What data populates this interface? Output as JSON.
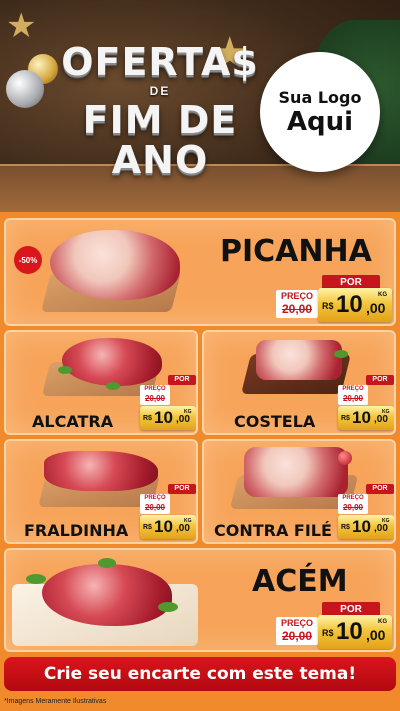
{
  "header": {
    "title_line1": "OFERTA$",
    "title_line2": "DE",
    "title_line3": "FIM DE ANO",
    "logo_line1": "Sua Logo",
    "logo_line2": "Aqui"
  },
  "products": [
    {
      "name": "PICANHA",
      "badge": "-50%",
      "por_label": "POR",
      "preco_label": "PREÇO",
      "old_price": "20,00",
      "currency": "R$",
      "price_int": "10",
      "price_cents": ",00",
      "unit": "KG"
    },
    {
      "name": "ALCATRA",
      "por_label": "POR",
      "preco_label": "PREÇO",
      "old_price": "20,00",
      "currency": "R$",
      "price_int": "10",
      "price_cents": ",00",
      "unit": "KG"
    },
    {
      "name": "COSTELA",
      "por_label": "POR",
      "preco_label": "PREÇO",
      "old_price": "20,00",
      "currency": "R$",
      "price_int": "10",
      "price_cents": ",00",
      "unit": "KG"
    },
    {
      "name": "FRALDINHA",
      "por_label": "POR",
      "preco_label": "PREÇO",
      "old_price": "20,00",
      "currency": "R$",
      "price_int": "10",
      "price_cents": ",00",
      "unit": "KG"
    },
    {
      "name": "CONTRA FILÉ",
      "por_label": "POR",
      "preco_label": "PREÇO",
      "old_price": "20,00",
      "currency": "R$",
      "price_int": "10",
      "price_cents": ",00",
      "unit": "KG"
    },
    {
      "name": "ACÉM",
      "por_label": "POR",
      "preco_label": "PREÇO",
      "old_price": "20,00",
      "currency": "R$",
      "price_int": "10",
      "price_cents": ",00",
      "unit": "KG"
    }
  ],
  "cta": "Crie seu encarte com este tema!",
  "footer_note": "*Imagens Meramente Ilustrativas",
  "colors": {
    "red": "#c4161c",
    "orange": "#f08a2a",
    "gold": "#f3c53c"
  }
}
